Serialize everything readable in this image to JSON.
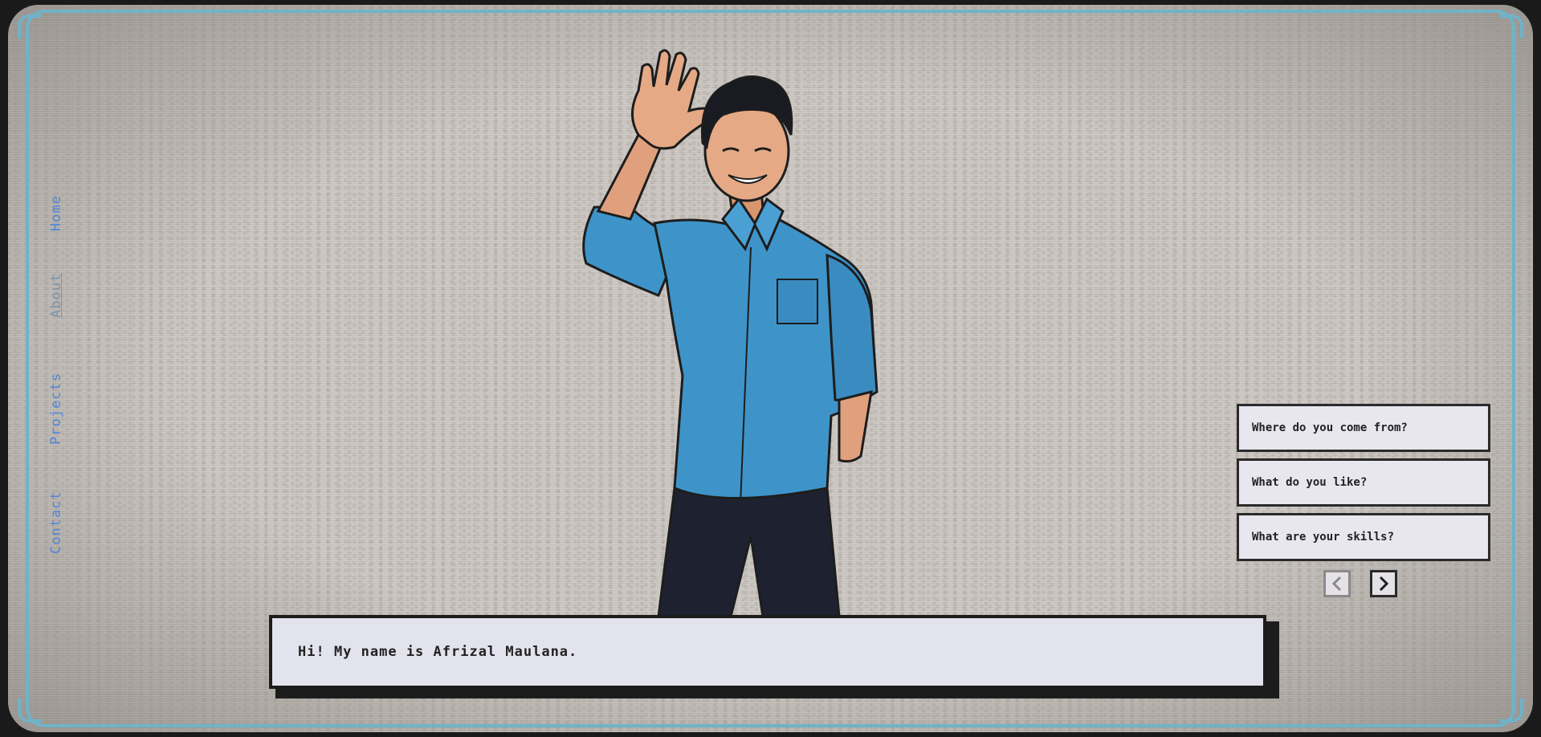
{
  "nav": {
    "items": [
      {
        "label": "Home",
        "active": false
      },
      {
        "label": "About",
        "active": true
      },
      {
        "label": "Projects",
        "active": false
      },
      {
        "label": "Contact",
        "active": false
      }
    ]
  },
  "dialogue": {
    "text": "Hi! My name is Afrizal Maulana."
  },
  "choices": [
    {
      "label": "Where do you come from?"
    },
    {
      "label": "What do you like?"
    },
    {
      "label": "What are your skills?"
    }
  ],
  "pager": {
    "prev_icon": "chevron-left-icon",
    "next_icon": "chevron-right-icon",
    "prev_disabled": true
  },
  "colors": {
    "frame": "#6fb3c8",
    "nav_link": "#4f86d9",
    "shirt": "#3e94c9",
    "dialogue_bg": "#e3e3ee"
  }
}
